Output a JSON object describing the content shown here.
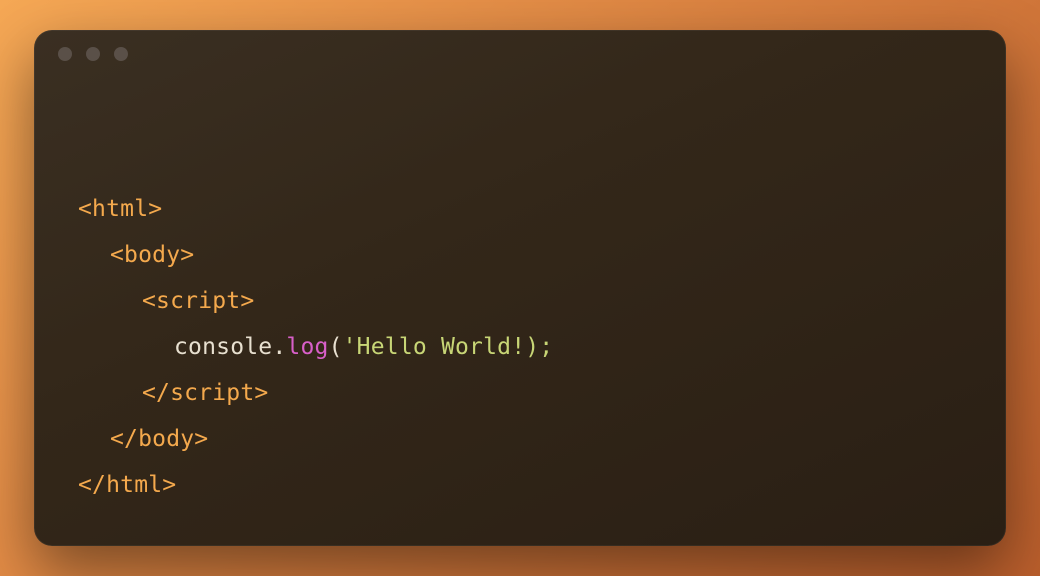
{
  "code": {
    "line1": {
      "tag_open": "<html>"
    },
    "line2": {
      "tag_open": "<body>"
    },
    "line3": {
      "tag_open": "<script>"
    },
    "line4": {
      "obj": "console",
      "dot": ".",
      "method": "log",
      "paren_open": "(",
      "string": "'Hello World!);"
    },
    "line5": {
      "tag_close": "</script>"
    },
    "line6": {
      "tag_close": "</body>"
    },
    "line7": {
      "tag_close": "</html>"
    }
  },
  "colors": {
    "tag": "#f4a94d",
    "plain": "#e8e0d0",
    "method": "#d85fc9",
    "string": "#c8d676",
    "dot": "#5a5048"
  }
}
